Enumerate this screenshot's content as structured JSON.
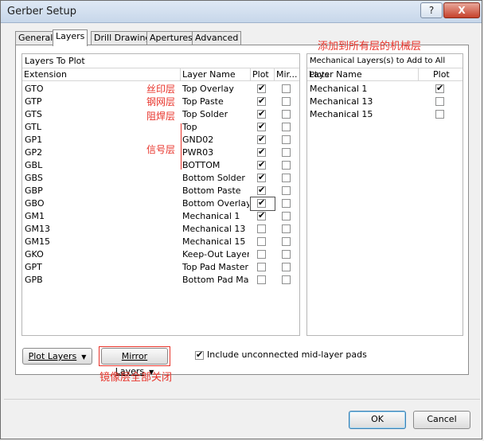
{
  "window": {
    "title": "Gerber Setup",
    "help_label": "?",
    "close_label": "X"
  },
  "tabs": [
    {
      "label": "General"
    },
    {
      "label": "Layers"
    },
    {
      "label": "Drill Drawing"
    },
    {
      "label": "Apertures"
    },
    {
      "label": "Advanced"
    }
  ],
  "layers_to_plot": {
    "title": "Layers To Plot",
    "columns": {
      "extension": "Extension",
      "layer_name": "Layer Name",
      "plot": "Plot",
      "mirror": "Mir..."
    },
    "rows": [
      {
        "ext": "GTO",
        "name": "Top Overlay",
        "plot": true,
        "mirror": false
      },
      {
        "ext": "GTP",
        "name": "Top Paste",
        "plot": true,
        "mirror": false
      },
      {
        "ext": "GTS",
        "name": "Top Solder",
        "plot": true,
        "mirror": false
      },
      {
        "ext": "GTL",
        "name": "Top",
        "plot": true,
        "mirror": false
      },
      {
        "ext": "GP1",
        "name": "GND02",
        "plot": true,
        "mirror": false
      },
      {
        "ext": "GP2",
        "name": "PWR03",
        "plot": true,
        "mirror": false
      },
      {
        "ext": "GBL",
        "name": "BOTTOM",
        "plot": true,
        "mirror": false
      },
      {
        "ext": "GBS",
        "name": "Bottom Solder",
        "plot": true,
        "mirror": false
      },
      {
        "ext": "GBP",
        "name": "Bottom Paste",
        "plot": true,
        "mirror": false
      },
      {
        "ext": "GBO",
        "name": "Bottom Overlay",
        "plot": true,
        "mirror": false
      },
      {
        "ext": "GM1",
        "name": "Mechanical 1",
        "plot": true,
        "mirror": false
      },
      {
        "ext": "GM13",
        "name": "Mechanical 13",
        "plot": false,
        "mirror": false
      },
      {
        "ext": "GM15",
        "name": "Mechanical 15",
        "plot": false,
        "mirror": false
      },
      {
        "ext": "GKO",
        "name": "Keep-Out Layer",
        "plot": false,
        "mirror": false
      },
      {
        "ext": "GPT",
        "name": "Top Pad Master",
        "plot": false,
        "mirror": false
      },
      {
        "ext": "GPB",
        "name": "Bottom Pad Master",
        "plot": false,
        "mirror": false
      }
    ]
  },
  "mechanical": {
    "title": "Mechanical Layers(s) to Add to All Plots",
    "columns": {
      "layer_name": "Layer Name",
      "plot": "Plot"
    },
    "rows": [
      {
        "name": "Mechanical 1",
        "plot": true
      },
      {
        "name": "Mechanical 13",
        "plot": false
      },
      {
        "name": "Mechanical 15",
        "plot": false
      }
    ]
  },
  "annotations": {
    "silkscreen": "丝印层",
    "paste": "钢网层",
    "solder": "阻焊层",
    "signal": "信号层",
    "mech_all": "添加到所有层的机械层",
    "mirror_off": "镜像层全部关闭"
  },
  "bottom": {
    "plot_layers": "Plot Layers",
    "mirror_layers": "Mirror Layers",
    "include_pads": "Include unconnected mid-layer pads",
    "include_pads_checked": true
  },
  "footer": {
    "ok": "OK",
    "cancel": "Cancel"
  },
  "colors": {
    "annotation_red": "#e8332a"
  }
}
